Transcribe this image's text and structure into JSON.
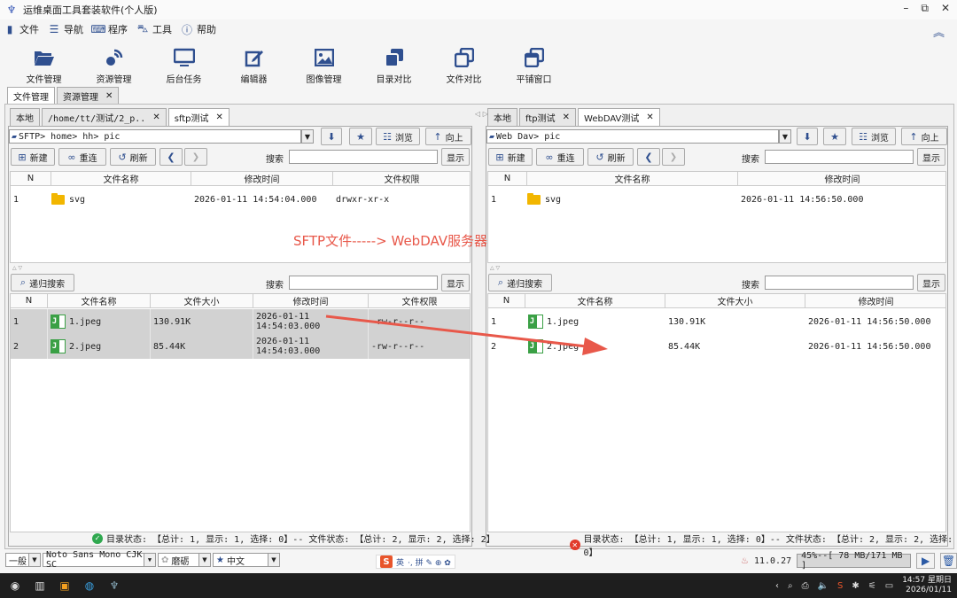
{
  "window": {
    "title": "运维桌面工具套装软件(个人版)",
    "minimize": "–",
    "restore": "⧉",
    "close": "✕"
  },
  "menu": [
    {
      "label": "文件",
      "icon": "file-icon"
    },
    {
      "label": "导航",
      "icon": "hamburger-icon"
    },
    {
      "label": "程序",
      "icon": "keyboard-icon"
    },
    {
      "label": "工具",
      "icon": "toolbox-icon"
    },
    {
      "label": "帮助",
      "icon": "help-icon"
    }
  ],
  "toolbar": [
    {
      "label": "文件管理",
      "icon": "folder-open-icon"
    },
    {
      "label": "资源管理",
      "icon": "satellite-icon"
    },
    {
      "label": "后台任务",
      "icon": "monitor-icon"
    },
    {
      "label": "编辑器",
      "icon": "edit-icon"
    },
    {
      "label": "图像管理",
      "icon": "image-icon"
    },
    {
      "label": "目录对比",
      "icon": "clone-dir-icon"
    },
    {
      "label": "文件对比",
      "icon": "clone-file-icon"
    },
    {
      "label": "平铺窗口",
      "icon": "tile-window-icon"
    }
  ],
  "main_tabs": [
    {
      "label": "文件管理",
      "active": true,
      "closable": false
    },
    {
      "label": "资源管理",
      "active": false,
      "closable": true
    }
  ],
  "close_glyph": "✕",
  "left": {
    "tabs": [
      {
        "label": "本地",
        "active": false,
        "closable": false
      },
      {
        "label": "/home/tt/测试/2_p..",
        "active": false,
        "closable": true
      },
      {
        "label": "sftp测试",
        "active": true,
        "closable": true
      }
    ],
    "path": "SFTP> home> hh> pic",
    "buttons": {
      "browse": "浏览",
      "up": "向上",
      "new": "新建",
      "reconnect": "重连",
      "refresh": "刷新",
      "search": "搜索",
      "show": "显示",
      "recursive": "递归搜索"
    },
    "dir_headers": [
      "N",
      "文件名称",
      "修改时间",
      "文件权限"
    ],
    "dirs": [
      {
        "n": "1",
        "name": "svg",
        "mtime": "2026-01-11 14:54:04.000",
        "perm": "drwxr-xr-x"
      }
    ],
    "file_headers": [
      "N",
      "文件名称",
      "文件大小",
      "修改时间",
      "文件权限"
    ],
    "files": [
      {
        "n": "1",
        "name": "1.jpeg",
        "size": "130.91K",
        "mtime": "2026-01-11 14:54:03.000",
        "perm": "-rw-r--r--"
      },
      {
        "n": "2",
        "name": "2.jpeg",
        "size": "85.44K",
        "mtime": "2026-01-11 14:54:03.000",
        "perm": "-rw-r--r--"
      }
    ],
    "status": "目录状态: 【总计: 1, 显示: 1, 选择: 0】-- 文件状态: 【总计: 2, 显示: 2, 选择: 2】"
  },
  "right": {
    "tabs": [
      {
        "label": "本地",
        "active": false,
        "closable": false
      },
      {
        "label": "ftp测试",
        "active": false,
        "closable": true
      },
      {
        "label": "WebDAV测试",
        "active": true,
        "closable": true
      }
    ],
    "path": "Web Dav> pic",
    "buttons": {
      "browse": "浏览",
      "up": "向上",
      "new": "新建",
      "reconnect": "重连",
      "refresh": "刷新",
      "search": "搜索",
      "show": "显示",
      "recursive": "递归搜索"
    },
    "dir_headers": [
      "N",
      "文件名称",
      "修改时间"
    ],
    "dirs": [
      {
        "n": "1",
        "name": "svg",
        "mtime": "2026-01-11 14:56:50.000"
      }
    ],
    "file_headers": [
      "N",
      "文件名称",
      "文件大小",
      "修改时间"
    ],
    "files": [
      {
        "n": "1",
        "name": "1.jpeg",
        "size": "130.91K",
        "mtime": "2026-01-11 14:56:50.000"
      },
      {
        "n": "2",
        "name": "2.jpeg",
        "size": "85.44K",
        "mtime": "2026-01-11 14:56:50.000"
      }
    ],
    "status": "目录状态: 【总计: 1, 显示: 1, 选择: 0】-- 文件状态: 【总计: 2, 显示: 2, 选择: 0】"
  },
  "annotation": "SFTP文件-----> WebDAV服务器",
  "bottom": {
    "mode": "一般",
    "font": "Noto Sans Mono CJK SC",
    "theme": "磨砺",
    "language": "中文",
    "ime_label": "英",
    "ime_extra": "·, 拼 ✎ ⊕ ✿",
    "java_version": "11.0.27",
    "memory": "45%--[ 78 MB/171 MB ]"
  },
  "taskbar": {
    "time": "14:57 星期日",
    "date": "2026/01/11"
  },
  "colors": {
    "accent": "#2f4f8f",
    "annotation": "#e8584a",
    "ok": "#2fa84f",
    "error": "#e23b2b"
  }
}
